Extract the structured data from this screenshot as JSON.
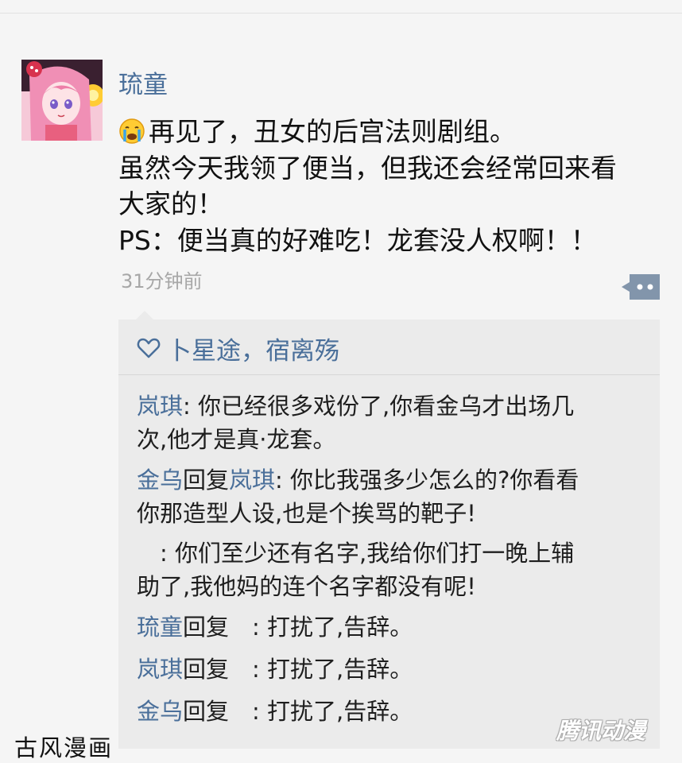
{
  "post": {
    "username": "琉童",
    "lines": [
      "再见了，丑女的后宫法则剧组。",
      "虽然今天我领了便当，但我还会经常回来看",
      "大家的！",
      "PS：便当真的好难吃！龙套没人权啊！！"
    ],
    "timestamp": "31分钟前"
  },
  "likes": {
    "text": "卜星途，宿离殇"
  },
  "comments": [
    {
      "name": "岚琪",
      "lines": [
        ": 你已经很多戏份了,你看金乌才出场几",
        "次,他才是真·龙套。"
      ]
    },
    {
      "name": "金乌",
      "reply_word": "回复",
      "reply_to": "岚琪",
      "lines": [
        ": 你比我强多少怎么的?你看看",
        "你那造型人设,也是个挨骂的靶子!"
      ]
    },
    {
      "lines": [
        ": 你们至少还有名字,我给你们打一晚上辅",
        "助了,我他妈的连个名字都没有呢!"
      ]
    },
    {
      "name": "琉童",
      "reply_word": "回复",
      "text": ": 打扰了,告辞。"
    },
    {
      "name": "岚琪",
      "reply_word": "回复",
      "text": ": 打扰了,告辞。"
    },
    {
      "name": "金乌",
      "reply_word": "回复",
      "text": ": 打扰了,告辞。"
    }
  ],
  "watermarks": {
    "left": "古风漫画",
    "right": "腾讯动漫"
  },
  "colors": {
    "background": "#f5f5f5",
    "panel": "#ebebeb",
    "name_link": "#4a6f9a",
    "timestamp": "#a7a7a7",
    "comment_button": "#8295ab"
  },
  "icons": [
    "crying-face-emoji-icon",
    "comment-bubble-icon",
    "heart-outline-icon"
  ]
}
